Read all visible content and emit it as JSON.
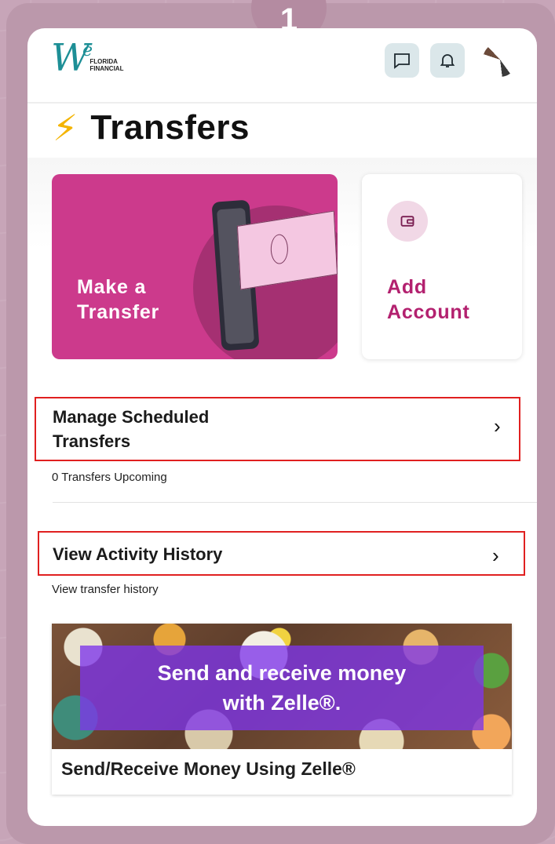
{
  "step_badge": "1",
  "header": {
    "logo_mark": "W",
    "logo_e": "e",
    "logo_text_line1": "FLORIDA",
    "logo_text_line2": "FINANCIAL",
    "chat_icon": "chat-icon",
    "bell_icon": "bell-icon"
  },
  "page": {
    "title_icon": "⚡",
    "title": "Transfers"
  },
  "cards": {
    "make_transfer": {
      "line1": "Make a",
      "line2": "Transfer"
    },
    "add_account": {
      "line1": "Add",
      "line2": "Account",
      "icon": "wallet-icon"
    }
  },
  "scheduled": {
    "title_line1": "Manage Scheduled",
    "title_line2": "Transfers",
    "subtitle": "0 Transfers Upcoming",
    "chevron": "›"
  },
  "history": {
    "title": "View Activity History",
    "subtitle": "View transfer history",
    "chevron": "›"
  },
  "promo": {
    "overlay_line1": "Send and receive money",
    "overlay_line2": "with Zelle®.",
    "caption": "Send/Receive Money Using Zelle®"
  },
  "colors": {
    "brand_teal": "#1d8f96",
    "brand_pink": "#cc3a8c",
    "accent_text": "#b3216f",
    "highlight_red": "#e02020",
    "zelle_purple": "#7d34eb"
  }
}
